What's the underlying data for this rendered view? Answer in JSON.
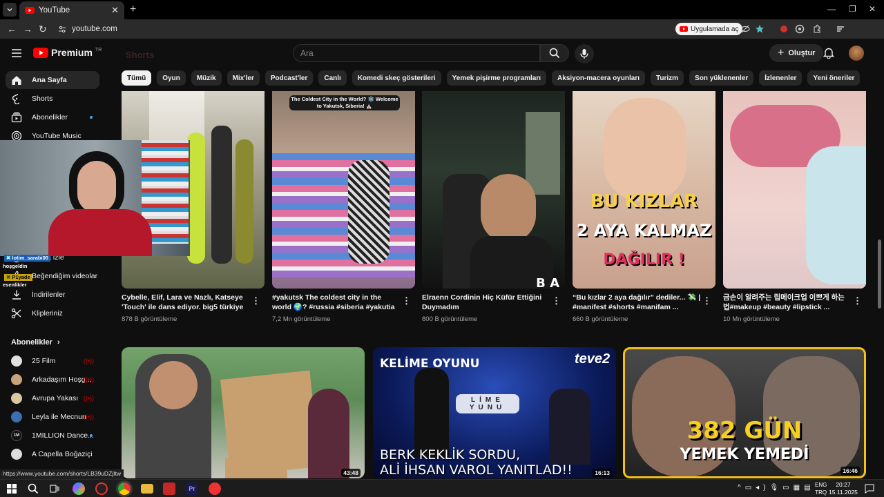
{
  "browser": {
    "tab_title": "YouTube",
    "url": "youtube.com",
    "open_app_label": "Uygulamada aç"
  },
  "header": {
    "logo_text": "Premium",
    "logo_superscript": "TR",
    "search_placeholder": "Ara",
    "create_label": "Oluştur"
  },
  "faded_label": "Shorts",
  "sidebar": {
    "items": [
      {
        "label": "Ana Sayfa",
        "icon": "home-icon"
      },
      {
        "label": "Shorts",
        "icon": "shorts-icon"
      },
      {
        "label": "Abonelikler",
        "icon": "subscriptions-icon"
      },
      {
        "label": "YouTube Music",
        "icon": "youtube-music-icon"
      },
      {
        "label": "Sonra izle",
        "icon": "watch-later-icon"
      },
      {
        "label": "Beğendiğim videolar",
        "icon": "like-icon"
      },
      {
        "label": "İndirilenler",
        "icon": "download-icon"
      },
      {
        "label": "Klipleriniz",
        "icon": "clips-icon"
      }
    ],
    "subs_header": "Abonelikler",
    "subscriptions": [
      {
        "name": "25 Film",
        "color": "#e0e0e0"
      },
      {
        "name": "Arkadaşım Hoşg...",
        "color": "#c9a27e"
      },
      {
        "name": "Avrupa Yakası",
        "color": "#d8c8a0"
      },
      {
        "name": "Leyla ile Mecnun",
        "color": "#3a6fb0"
      },
      {
        "name": "1MILLION Dance...",
        "color": "#111111"
      },
      {
        "name": "A Capella Boğaziçi",
        "color": "#dddddd"
      }
    ]
  },
  "chips": [
    "Tümü",
    "Oyun",
    "Müzik",
    "Mix'ler",
    "Podcast'ler",
    "Canlı",
    "Komedi skeç gösterileri",
    "Yemek pişirme programları",
    "Aksiyon-macera oyunları",
    "Turizm",
    "Son yüklenenler",
    "İzlenenler",
    "Yeni öneriler"
  ],
  "shorts": [
    {
      "title": "Cybelle, Elif, Lara ve Nazlı, Katseye 'Touch' ile dans ediyor. big5 türkiye ...",
      "views": "878 B görüntüleme"
    },
    {
      "title": "#yakutsk The coldest city in the world 🌍? #russia #siberia #yakutia ...",
      "views": "7,2 Mn görüntüleme",
      "overlay": "The Coldest City in the World? ❄️ Welcome to Yakutsk, Siberia! ⛪"
    },
    {
      "title": "Elraenn Cordinin Hiç Küfür Ettiğini Duymadım",
      "views": "800 B görüntüleme",
      "overlay": "B A"
    },
    {
      "title": "“Bu kızlar 2 aya dağılır” dediler... 💸 | #manifest #shorts #manifam ...",
      "views": "660 B görüntüleme",
      "overlay_lines": [
        "BU KIZLAR",
        "2 AYA KALMAZ",
        "DAĞILIR !"
      ]
    },
    {
      "title": "금손이 알려주는 립메이크업 이쁘게 하는 법#makeup #beauty #lipstick ...",
      "views": "10 Mn görüntüleme"
    }
  ],
  "videos": [
    {
      "duration": "43:48",
      "overlay": ""
    },
    {
      "duration": "16:13",
      "top_title": "KELİME OYUNU",
      "channel": "teve2",
      "tiles": "LİME YUNU",
      "caption_lines": [
        "BERK KEKLİK SORDU,",
        "ALİ İHSAN VAROL YANITLAD!!"
      ]
    },
    {
      "duration": "16:46",
      "caption_lines": [
        "382 GÜN",
        "YEMEK YEMEDİ"
      ]
    }
  ],
  "stream_chat": [
    {
      "user": "lotim_sarabi00",
      "msg": "hoşgeldin",
      "color": "#1a5fb4"
    },
    {
      "user": "P1yade",
      "msg": "esenlikler",
      "color": "#c8a20e"
    }
  ],
  "status_url": "https://www.youtube.com/shorts/LB39uDZjItw",
  "taskbar": {
    "lang_lines": [
      "ENG",
      "TRQ"
    ],
    "time": "20:27",
    "date": "15.11.2025"
  }
}
